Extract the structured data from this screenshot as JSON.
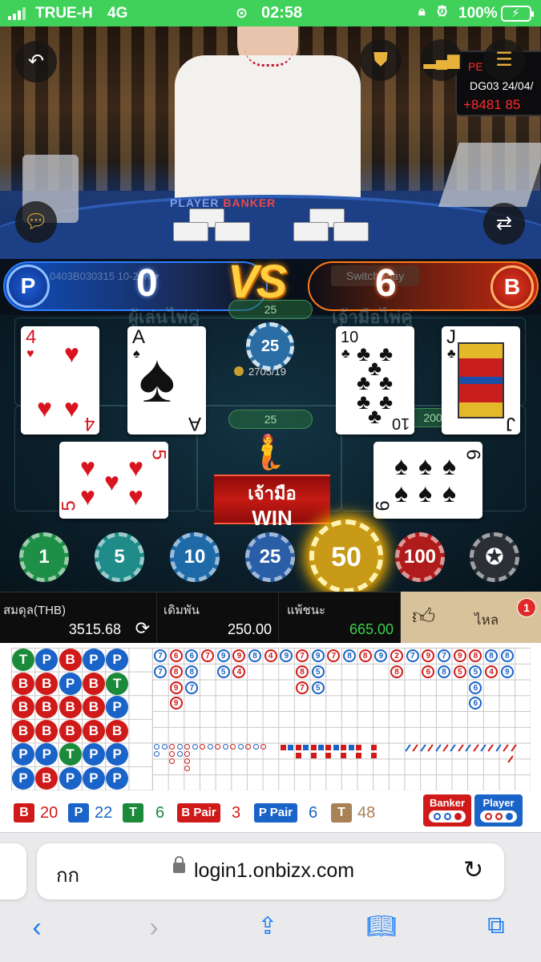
{
  "status_bar": {
    "carrier": "TRUE-H",
    "network": "4G",
    "time": "02:58",
    "battery_percent": "100%"
  },
  "video": {
    "screen_line1": "PE",
    "screen_line2": "DG03 24/04/",
    "screen_line3": "+8481 85",
    "table_label_player": "PLAYER",
    "table_label_banker": "BANKER",
    "icons": [
      "back-arrow-icon",
      "shield-check-icon",
      "signal-bars-icon",
      "menu-icon",
      "chat-icon",
      "switch-camera-icon"
    ]
  },
  "vs_bar": {
    "player_letter": "P",
    "banker_letter": "B",
    "table_id": "0403B030315  10-20K ▾",
    "player_score": "0",
    "banker_score": "6",
    "vs_text": "VS",
    "switch_label": "Switch Play"
  },
  "table": {
    "player_pair_label": "ผู้เล่นไพ่คู่",
    "banker_pair_label": "เจ้ามือไพ่คู่",
    "side_bet_amount_top": "25",
    "tie_chip_value": "25",
    "tie_counter": "2705/19",
    "main_bet_amount": "25",
    "banker_side_amount": "200",
    "winner_text": "เจ้ามือ",
    "win_text": "WIN",
    "player_cards": [
      {
        "rank": "4",
        "suit": "♥",
        "color": "red"
      },
      {
        "rank": "A",
        "suit": "♠",
        "color": "black"
      },
      {
        "rank": "5",
        "suit": "♥",
        "color": "red"
      }
    ],
    "banker_cards": [
      {
        "rank": "10",
        "suit": "♣",
        "color": "black"
      },
      {
        "rank": "J",
        "suit": "♣",
        "color": "black"
      },
      {
        "rank": "6",
        "suit": "♠",
        "color": "black"
      }
    ]
  },
  "chips": [
    {
      "label": "1",
      "color": "#1e8f46"
    },
    {
      "label": "5",
      "color": "#1f8c8a"
    },
    {
      "label": "10",
      "color": "#1e6aa8"
    },
    {
      "label": "25",
      "color": "#2a5fa8"
    },
    {
      "label": "50",
      "color": "#c99a17",
      "selected": true
    },
    {
      "label": "100",
      "color": "#b01c1c"
    }
  ],
  "balance_bar": {
    "balance_label": "สมดุล(THB)",
    "balance_value": "3515.68",
    "bet_label": "เดิมพัน",
    "bet_value": "250.00",
    "winlose_label": "แพ้ชนะ",
    "winlose_value": "665.00",
    "like_label": "ไหล",
    "badge_count": "1"
  },
  "bead_road": [
    [
      "T",
      "B",
      "B",
      "B",
      "P",
      "P"
    ],
    [
      "P",
      "B",
      "B",
      "B",
      "P",
      "B"
    ],
    [
      "B",
      "P",
      "B",
      "B",
      "T",
      "P"
    ],
    [
      "P",
      "B",
      "B",
      "B",
      "P",
      "P"
    ],
    [
      "P",
      "T",
      "P",
      "B",
      "P",
      "P"
    ]
  ],
  "big_road": [
    {
      "c": 0,
      "r": 0,
      "s": "P",
      "v": "7"
    },
    {
      "c": 0,
      "r": 1,
      "s": "P",
      "v": "7"
    },
    {
      "c": 1,
      "r": 0,
      "s": "B",
      "v": "6",
      "tie": true
    },
    {
      "c": 1,
      "r": 1,
      "s": "B",
      "v": "8"
    },
    {
      "c": 1,
      "r": 2,
      "s": "B",
      "v": "9"
    },
    {
      "c": 1,
      "r": 3,
      "s": "B",
      "v": "9"
    },
    {
      "c": 2,
      "r": 0,
      "s": "P",
      "v": "6"
    },
    {
      "c": 2,
      "r": 1,
      "s": "P",
      "v": "8"
    },
    {
      "c": 2,
      "r": 2,
      "s": "P",
      "v": "7"
    },
    {
      "c": 3,
      "r": 0,
      "s": "B",
      "v": "7"
    },
    {
      "c": 4,
      "r": 0,
      "s": "P",
      "v": "9",
      "tie": true
    },
    {
      "c": 4,
      "r": 1,
      "s": "P",
      "v": "5"
    },
    {
      "c": 5,
      "r": 0,
      "s": "B",
      "v": "9"
    },
    {
      "c": 5,
      "r": 1,
      "s": "B",
      "v": "4"
    },
    {
      "c": 6,
      "r": 0,
      "s": "P",
      "v": "8"
    },
    {
      "c": 7,
      "r": 0,
      "s": "B",
      "v": "4"
    },
    {
      "c": 8,
      "r": 0,
      "s": "P",
      "v": "9"
    },
    {
      "c": 9,
      "r": 0,
      "s": "B",
      "v": "7"
    },
    {
      "c": 9,
      "r": 1,
      "s": "B",
      "v": "8"
    },
    {
      "c": 9,
      "r": 2,
      "s": "B",
      "v": "7"
    },
    {
      "c": 10,
      "r": 0,
      "s": "P",
      "v": "9"
    },
    {
      "c": 10,
      "r": 1,
      "s": "P",
      "v": "5"
    },
    {
      "c": 10,
      "r": 2,
      "s": "P",
      "v": "5"
    },
    {
      "c": 11,
      "r": 0,
      "s": "B",
      "v": "7"
    },
    {
      "c": 12,
      "r": 0,
      "s": "P",
      "v": "8"
    },
    {
      "c": 13,
      "r": 0,
      "s": "B",
      "v": "8"
    },
    {
      "c": 14,
      "r": 0,
      "s": "P",
      "v": "9"
    },
    {
      "c": 15,
      "r": 0,
      "s": "B",
      "v": "2"
    },
    {
      "c": 15,
      "r": 1,
      "s": "B",
      "v": "8"
    },
    {
      "c": 16,
      "r": 0,
      "s": "P",
      "v": "7"
    },
    {
      "c": 17,
      "r": 0,
      "s": "B",
      "v": "9"
    },
    {
      "c": 17,
      "r": 1,
      "s": "B",
      "v": "6",
      "tie": true
    },
    {
      "c": 18,
      "r": 0,
      "s": "P",
      "v": "7"
    },
    {
      "c": 18,
      "r": 1,
      "s": "P",
      "v": "8"
    },
    {
      "c": 19,
      "r": 0,
      "s": "B",
      "v": "9"
    },
    {
      "c": 19,
      "r": 1,
      "s": "B",
      "v": "5"
    },
    {
      "c": 20,
      "r": 0,
      "s": "B",
      "v": "8"
    },
    {
      "c": 20,
      "r": 1,
      "s": "P",
      "v": "5"
    },
    {
      "c": 20,
      "r": 2,
      "s": "P",
      "v": "6"
    },
    {
      "c": 20,
      "r": 3,
      "s": "P",
      "v": "6",
      "tie": true
    },
    {
      "c": 21,
      "r": 0,
      "s": "P",
      "v": "8"
    },
    {
      "c": 21,
      "r": 1,
      "s": "B",
      "v": "4"
    },
    {
      "c": 22,
      "r": 0,
      "s": "P",
      "v": "8"
    },
    {
      "c": 22,
      "r": 1,
      "s": "P",
      "v": "9"
    }
  ],
  "stats": {
    "banker_label": "B",
    "banker_count": "20",
    "player_label": "P",
    "player_count": "22",
    "tie_label": "T",
    "tie_count": "6",
    "banker_pair_label": "B Pair",
    "banker_pair_count": "3",
    "player_pair_label": "P Pair",
    "player_pair_count": "6",
    "total_label": "T",
    "total_count": "48",
    "ask_banker_label": "Banker",
    "ask_player_label": "Player"
  },
  "browser": {
    "keyboard_hint": "กก",
    "url": "login1.onbizx.com",
    "nav_icons": [
      "back-icon",
      "forward-icon",
      "share-icon",
      "bookmarks-icon",
      "tabs-icon"
    ]
  },
  "colors": {
    "banker": "#d01a1a",
    "player": "#1a63c8",
    "tie": "#1b8a3a",
    "status_bar": "#3fd15a",
    "win_green": "#39d04a"
  }
}
